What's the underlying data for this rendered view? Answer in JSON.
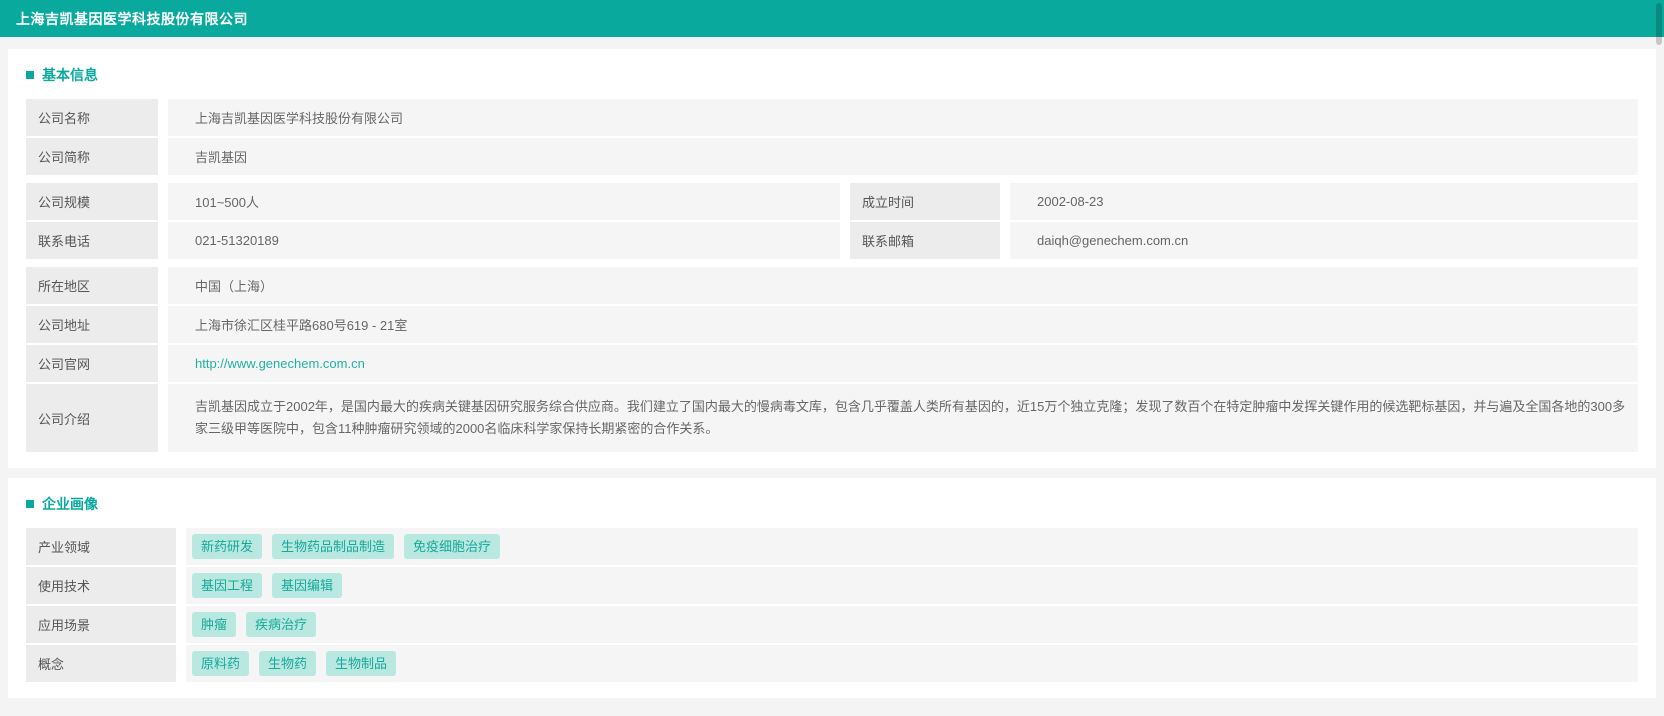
{
  "header": {
    "title": "上海吉凯基因医学科技股份有限公司"
  },
  "colors": {
    "accent": "#0aa99e",
    "link": "#24b0a4",
    "tag_bg": "#b9e8e1",
    "tag_text": "#17a89b",
    "label_bg": "#ececec",
    "value_bg": "#f5f5f5"
  },
  "basic_info": {
    "section_title": "基本信息",
    "company_name": {
      "label": "公司名称",
      "value": "上海吉凯基因医学科技股份有限公司"
    },
    "company_short": {
      "label": "公司简称",
      "value": "吉凯基因"
    },
    "company_size": {
      "label": "公司规模",
      "value": "101~500人"
    },
    "founded": {
      "label": "成立时间",
      "value": "2002-08-23"
    },
    "phone": {
      "label": "联系电话",
      "value": "021-51320189"
    },
    "email": {
      "label": "联系邮箱",
      "value": "daiqh@genechem.com.cn"
    },
    "region": {
      "label": "所在地区",
      "value": "中国（上海）"
    },
    "address": {
      "label": "公司地址",
      "value": "上海市徐汇区桂平路680号619 - 21室"
    },
    "website": {
      "label": "公司官网",
      "value": "http://www.genechem.com.cn"
    },
    "intro": {
      "label": "公司介绍",
      "value": "吉凯基因成立于2002年，是国内最大的疾病关键基因研究服务综合供应商。我们建立了国内最大的慢病毒文库，包含几乎覆盖人类所有基因的，近15万个独立克隆；发现了数百个在特定肿瘤中发挥关键作用的候选靶标基因，并与遍及全国各地的300多家三级甲等医院中，包含11种肿瘤研究领域的2000名临床科学家保持长期紧密的合作关系。"
    }
  },
  "portrait": {
    "section_title": "企业画像",
    "rows": [
      {
        "label": "产业领域",
        "tags": [
          "新药研发",
          "生物药品制品制造",
          "免疫细胞治疗"
        ]
      },
      {
        "label": "使用技术",
        "tags": [
          "基因工程",
          "基因编辑"
        ]
      },
      {
        "label": "应用场景",
        "tags": [
          "肿瘤",
          "疾病治疗"
        ]
      },
      {
        "label": "概念",
        "tags": [
          "原料药",
          "生物药",
          "生物制品"
        ]
      }
    ]
  }
}
